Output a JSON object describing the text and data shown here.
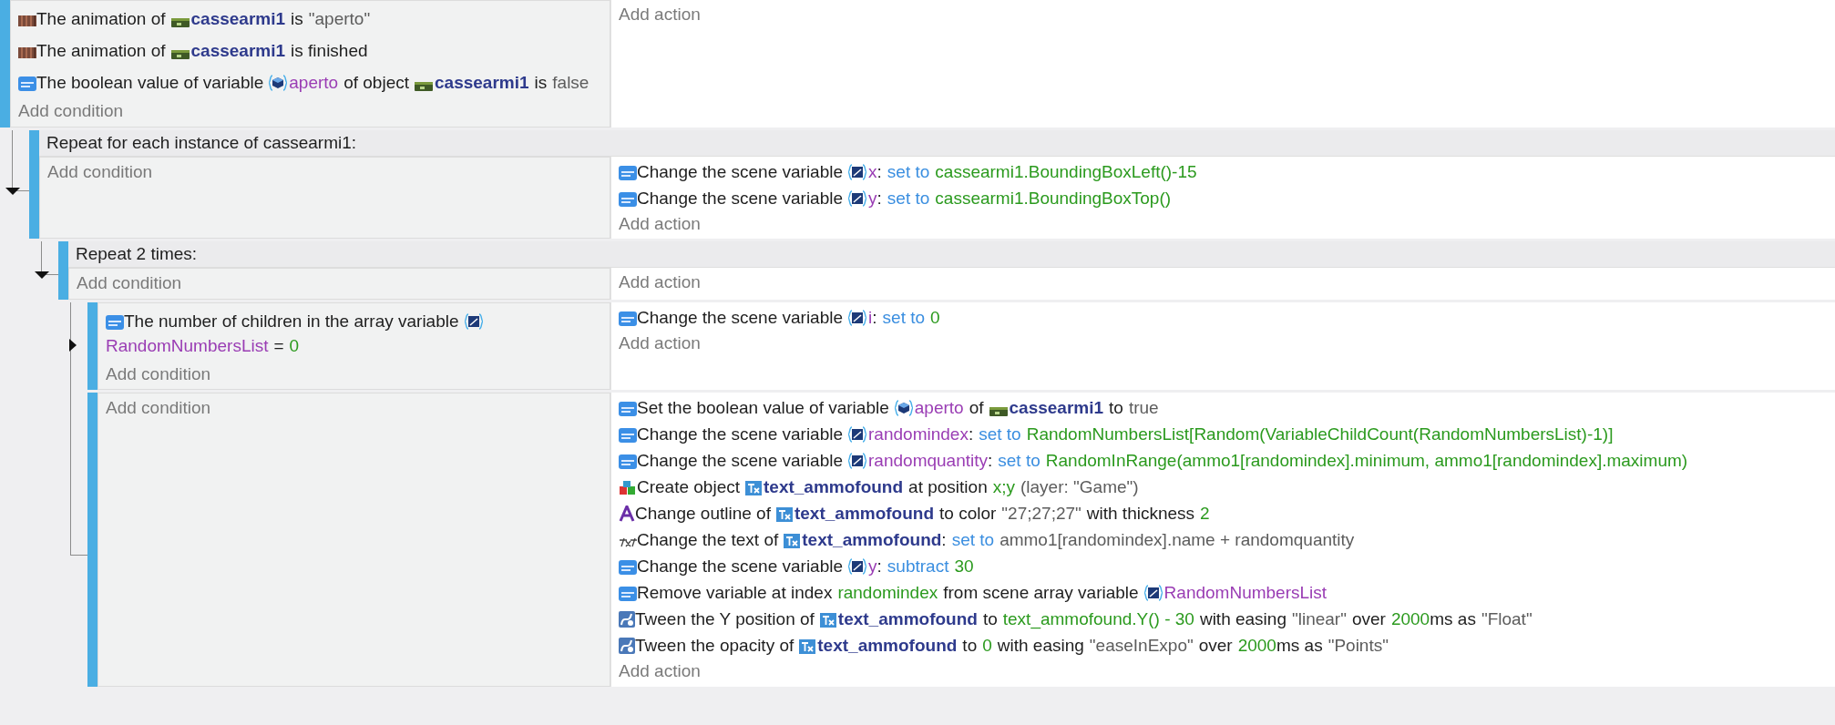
{
  "events": [
    {
      "kind": "standard",
      "add_condition": "Add condition",
      "add_action": "Add action",
      "conditions": [
        {
          "kind": "animation",
          "parts": [
            {
              "kind": "text",
              "text": "The animation of"
            },
            {
              "kind": "sprite_object",
              "text": "cassearmi1"
            },
            {
              "kind": "text",
              "text": "is"
            },
            {
              "kind": "string",
              "text": "\"aperto\""
            }
          ]
        },
        {
          "kind": "animation",
          "parts": [
            {
              "kind": "text",
              "text": "The animation of"
            },
            {
              "kind": "sprite_object",
              "text": "cassearmi1"
            },
            {
              "kind": "text",
              "text": "is finished"
            }
          ]
        },
        {
          "kind": "variable",
          "parts": [
            {
              "kind": "text",
              "text": "The boolean value of variable"
            },
            {
              "kind": "object_variable",
              "text": "aperto"
            },
            {
              "kind": "text",
              "text": "of object"
            },
            {
              "kind": "sprite_object",
              "text": "cassearmi1"
            },
            {
              "kind": "text",
              "text": "is"
            },
            {
              "kind": "string",
              "text": "false"
            }
          ]
        }
      ],
      "children": [
        {
          "kind": "repeat",
          "header": "Repeat for each instance of cassearmi1:",
          "add_condition": "Add condition",
          "add_action": "Add action",
          "collapsed": false,
          "actions": [
            {
              "kind": "variable",
              "parts": [
                {
                  "kind": "text",
                  "text": "Change the scene variable"
                },
                {
                  "kind": "scene_variable",
                  "text": "x"
                },
                {
                  "kind": "colon",
                  "text": ":"
                },
                {
                  "kind": "operator",
                  "text": "set to"
                },
                {
                  "kind": "value",
                  "text": "cassearmi1.BoundingBoxLeft()-15"
                }
              ]
            },
            {
              "kind": "variable",
              "parts": [
                {
                  "kind": "text",
                  "text": "Change the scene variable"
                },
                {
                  "kind": "scene_variable",
                  "text": "y"
                },
                {
                  "kind": "colon",
                  "text": ":"
                },
                {
                  "kind": "operator",
                  "text": "set to"
                },
                {
                  "kind": "value",
                  "text": "cassearmi1.BoundingBoxTop()"
                }
              ]
            }
          ],
          "children": [
            {
              "kind": "repeat",
              "header": "Repeat 2 times:",
              "add_condition": "Add condition",
              "add_action": "Add action",
              "collapsed": false,
              "children": [
                {
                  "kind": "standard",
                  "add_condition": "Add condition",
                  "add_action": "Add action",
                  "collapsed": true,
                  "conditions": [
                    {
                      "kind": "variable",
                      "parts": [
                        {
                          "kind": "text",
                          "text": "The number of children in the array variable"
                        },
                        {
                          "kind": "scene_variable",
                          "text": "RandomNumbersList"
                        },
                        {
                          "kind": "text",
                          "text": "="
                        },
                        {
                          "kind": "value",
                          "text": "0"
                        }
                      ]
                    }
                  ],
                  "actions": [
                    {
                      "kind": "variable",
                      "parts": [
                        {
                          "kind": "text",
                          "text": "Change the scene variable"
                        },
                        {
                          "kind": "scene_variable",
                          "text": "i"
                        },
                        {
                          "kind": "colon",
                          "text": ":"
                        },
                        {
                          "kind": "operator",
                          "text": "set to"
                        },
                        {
                          "kind": "value",
                          "text": "0"
                        }
                      ]
                    }
                  ]
                },
                {
                  "kind": "standard",
                  "add_condition": "Add condition",
                  "add_action": "Add action",
                  "actions": [
                    {
                      "kind": "variable",
                      "parts": [
                        {
                          "kind": "text",
                          "text": "Set the boolean value of variable"
                        },
                        {
                          "kind": "object_variable",
                          "text": "aperto"
                        },
                        {
                          "kind": "text",
                          "text": "of"
                        },
                        {
                          "kind": "sprite_object",
                          "text": "cassearmi1"
                        },
                        {
                          "kind": "text",
                          "text": "to"
                        },
                        {
                          "kind": "string",
                          "text": "true"
                        }
                      ]
                    },
                    {
                      "kind": "variable",
                      "parts": [
                        {
                          "kind": "text",
                          "text": "Change the scene variable"
                        },
                        {
                          "kind": "scene_variable",
                          "text": "randomindex"
                        },
                        {
                          "kind": "colon",
                          "text": ":"
                        },
                        {
                          "kind": "operator",
                          "text": "set to"
                        },
                        {
                          "kind": "value",
                          "text": "RandomNumbersList[Random(VariableChildCount(RandomNumbersList)-1)]"
                        }
                      ]
                    },
                    {
                      "kind": "variable",
                      "parts": [
                        {
                          "kind": "text",
                          "text": "Change the scene variable"
                        },
                        {
                          "kind": "scene_variable",
                          "text": "randomquantity"
                        },
                        {
                          "kind": "colon",
                          "text": ":"
                        },
                        {
                          "kind": "operator",
                          "text": "set to"
                        },
                        {
                          "kind": "value",
                          "text": "RandomInRange(ammo1[randomindex].minimum, ammo1[randomindex].maximum)"
                        }
                      ]
                    },
                    {
                      "kind": "create",
                      "parts": [
                        {
                          "kind": "text",
                          "text": "Create object"
                        },
                        {
                          "kind": "text_object",
                          "text": "text_ammofound"
                        },
                        {
                          "kind": "text",
                          "text": "at position"
                        },
                        {
                          "kind": "value",
                          "text": "x;y"
                        },
                        {
                          "kind": "string",
                          "text": "(layer: \"Game\")"
                        }
                      ]
                    },
                    {
                      "kind": "outline",
                      "parts": [
                        {
                          "kind": "text",
                          "text": "Change outline of"
                        },
                        {
                          "kind": "text_object",
                          "text": "text_ammofound"
                        },
                        {
                          "kind": "text",
                          "text": "to color"
                        },
                        {
                          "kind": "string",
                          "text": "\"27;27;27\""
                        },
                        {
                          "kind": "text",
                          "text": "with thickness"
                        },
                        {
                          "kind": "value",
                          "text": "2"
                        }
                      ]
                    },
                    {
                      "kind": "text",
                      "parts": [
                        {
                          "kind": "text",
                          "text": "Change the text of"
                        },
                        {
                          "kind": "text_object",
                          "text": "text_ammofound"
                        },
                        {
                          "kind": "colon",
                          "text": ":"
                        },
                        {
                          "kind": "operator",
                          "text": "set to"
                        },
                        {
                          "kind": "string",
                          "text": "ammo1[randomindex].name + randomquantity"
                        }
                      ]
                    },
                    {
                      "kind": "variable",
                      "parts": [
                        {
                          "kind": "text",
                          "text": "Change the scene variable"
                        },
                        {
                          "kind": "scene_variable",
                          "text": "y"
                        },
                        {
                          "kind": "colon",
                          "text": ":"
                        },
                        {
                          "kind": "operator",
                          "text": "subtract"
                        },
                        {
                          "kind": "value",
                          "text": "30"
                        }
                      ]
                    },
                    {
                      "kind": "variable",
                      "parts": [
                        {
                          "kind": "text",
                          "text": "Remove variable at index"
                        },
                        {
                          "kind": "value",
                          "text": "randomindex"
                        },
                        {
                          "kind": "text",
                          "text": "from scene array variable"
                        },
                        {
                          "kind": "scene_variable",
                          "text": "RandomNumbersList"
                        }
                      ]
                    },
                    {
                      "kind": "tween",
                      "parts": [
                        {
                          "kind": "text",
                          "text": "Tween the Y position of"
                        },
                        {
                          "kind": "text_object",
                          "text": "text_ammofound"
                        },
                        {
                          "kind": "text",
                          "text": "to"
                        },
                        {
                          "kind": "value",
                          "text": "text_ammofound.Y() - 30"
                        },
                        {
                          "kind": "text",
                          "text": "with easing"
                        },
                        {
                          "kind": "string",
                          "text": "\"linear\""
                        },
                        {
                          "kind": "text",
                          "text": "over"
                        },
                        {
                          "kind": "value",
                          "text": "2000"
                        },
                        {
                          "kind": "unit",
                          "text": "ms as"
                        },
                        {
                          "kind": "string",
                          "text": "\"Float\""
                        }
                      ]
                    },
                    {
                      "kind": "tween",
                      "parts": [
                        {
                          "kind": "text",
                          "text": "Tween the opacity of"
                        },
                        {
                          "kind": "text_object",
                          "text": "text_ammofound"
                        },
                        {
                          "kind": "text",
                          "text": "to"
                        },
                        {
                          "kind": "value",
                          "text": "0"
                        },
                        {
                          "kind": "text",
                          "text": "with easing"
                        },
                        {
                          "kind": "string",
                          "text": "\"easeInExpo\""
                        },
                        {
                          "kind": "text",
                          "text": "over"
                        },
                        {
                          "kind": "value",
                          "text": "2000"
                        },
                        {
                          "kind": "unit",
                          "text": "ms as"
                        },
                        {
                          "kind": "string",
                          "text": "\"Points\""
                        }
                      ]
                    }
                  ]
                }
              ]
            }
          ]
        }
      ]
    }
  ]
}
